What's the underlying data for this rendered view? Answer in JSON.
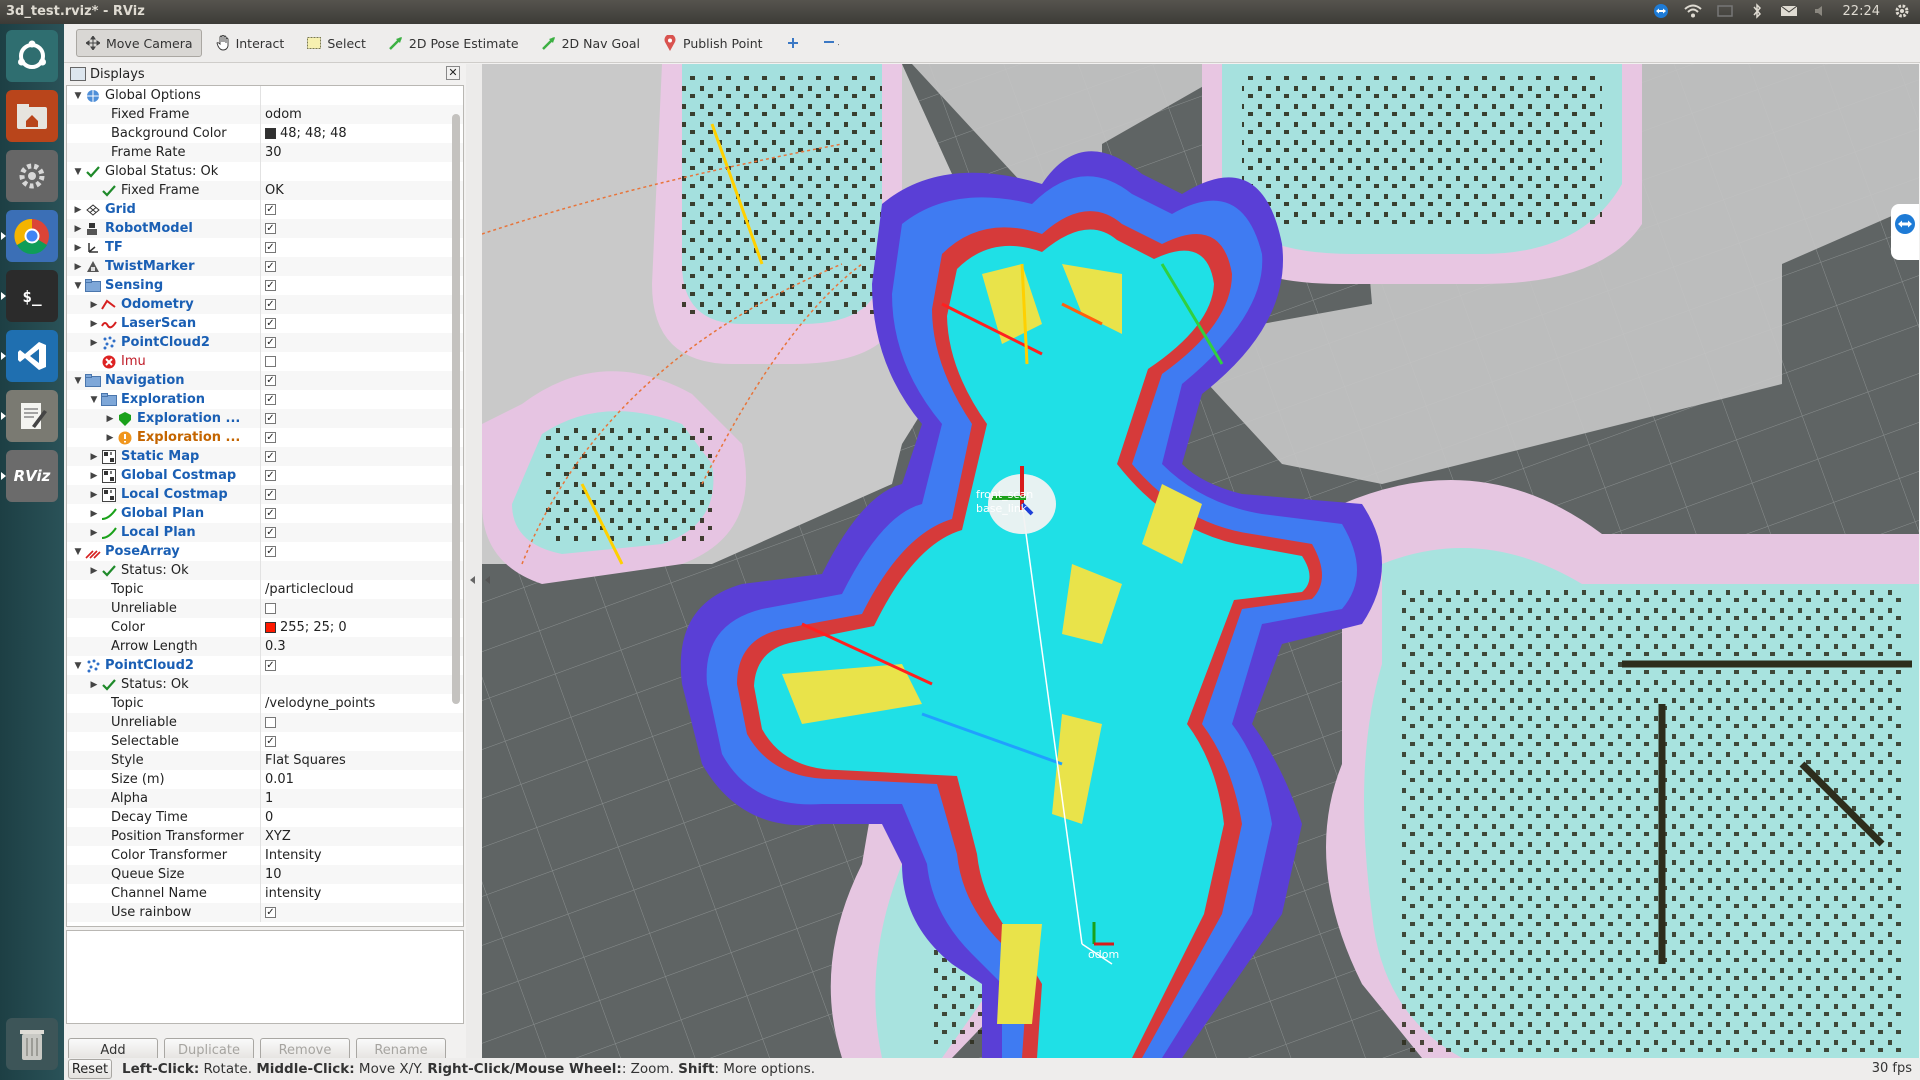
{
  "system_bar": {
    "window_title": "3d_test.rviz* - RViz",
    "clock": "22:24",
    "tray_icons": [
      "teamviewer-icon",
      "wifi-icon",
      "keyboard-icon",
      "bluetooth-icon",
      "mail-icon",
      "volume-icon",
      "gear-icon"
    ]
  },
  "launcher": {
    "items": [
      {
        "name": "ubuntu-dash",
        "icon": "ubuntu-logo-icon",
        "color": "#2f6e70"
      },
      {
        "name": "files",
        "icon": "home-folder-icon",
        "color": "#b9451b"
      },
      {
        "name": "system-settings",
        "icon": "gear-icon",
        "color": "#666666"
      },
      {
        "name": "chrome",
        "icon": "chrome-icon",
        "color": "#3b6fb6"
      },
      {
        "name": "terminal",
        "icon": "terminal-icon",
        "color": "#2b2b2b",
        "text": "$_"
      },
      {
        "name": "vscode",
        "icon": "vscode-icon",
        "color": "#1f6fb0"
      },
      {
        "name": "text-editor",
        "icon": "text-editor-icon",
        "color": "#7a7a72"
      },
      {
        "name": "rviz",
        "icon": "rviz-icon",
        "color": "#6b6b6b",
        "text": "RViz"
      },
      {
        "name": "trash",
        "icon": "trash-icon",
        "color": "#3d5558"
      }
    ]
  },
  "toolbar": {
    "tools": [
      {
        "label": "Move Camera",
        "icon": "move-camera-icon",
        "active": true
      },
      {
        "label": "Interact",
        "icon": "hand-icon",
        "active": false
      },
      {
        "label": "Select",
        "icon": "select-icon",
        "active": false
      },
      {
        "label": "2D Pose Estimate",
        "icon": "pose-estimate-arrow-icon",
        "active": false
      },
      {
        "label": "2D Nav Goal",
        "icon": "nav-goal-arrow-icon",
        "active": false
      },
      {
        "label": "Publish Point",
        "icon": "map-pin-icon",
        "active": false
      },
      {
        "label": "",
        "icon": "plus-icon",
        "active": false
      },
      {
        "label": "",
        "icon": "minus-dropdown-icon",
        "active": false
      }
    ]
  },
  "displays_panel": {
    "title": "Displays",
    "rows": [
      {
        "depth": 0,
        "expand": "open",
        "icon": "globe-icon",
        "name": "Global Options",
        "style": "plain",
        "value": ""
      },
      {
        "depth": 1,
        "expand": "",
        "icon": "",
        "name": "Fixed Frame",
        "style": "plain",
        "value": "odom"
      },
      {
        "depth": 1,
        "expand": "",
        "icon": "",
        "name": "Background Color",
        "style": "plain",
        "value": "48; 48; 48",
        "swatch": "#303030"
      },
      {
        "depth": 1,
        "expand": "",
        "icon": "",
        "name": "Frame Rate",
        "style": "plain",
        "value": "30"
      },
      {
        "depth": 0,
        "expand": "open",
        "icon": "check-icon",
        "name": "Global Status: Ok",
        "style": "plain",
        "value": ""
      },
      {
        "depth": 1,
        "expand": "",
        "icon": "check-icon",
        "name": "Fixed Frame",
        "style": "plain",
        "value": "OK"
      },
      {
        "depth": 0,
        "expand": "closed",
        "icon": "grid-icon",
        "name": "Grid",
        "style": "blue",
        "check": true
      },
      {
        "depth": 0,
        "expand": "closed",
        "icon": "robot-model-icon",
        "name": "RobotModel",
        "style": "blue",
        "check": true
      },
      {
        "depth": 0,
        "expand": "closed",
        "icon": "tf-axes-icon",
        "name": "TF",
        "style": "blue",
        "check": true
      },
      {
        "depth": 0,
        "expand": "closed",
        "icon": "marker-icon",
        "name": "TwistMarker",
        "style": "blue",
        "check": true
      },
      {
        "depth": 0,
        "expand": "open",
        "icon": "folder-icon",
        "name": "Sensing",
        "style": "blue",
        "check": true
      },
      {
        "depth": 1,
        "expand": "closed",
        "icon": "odometry-icon",
        "name": "Odometry",
        "style": "blue",
        "check": true
      },
      {
        "depth": 1,
        "expand": "closed",
        "icon": "laserscan-icon",
        "name": "LaserScan",
        "style": "blue",
        "check": true
      },
      {
        "depth": 1,
        "expand": "closed",
        "icon": "pointcloud-icon",
        "name": "PointCloud2",
        "style": "blue",
        "check": true
      },
      {
        "depth": 1,
        "expand": "",
        "icon": "error-icon",
        "name": "Imu",
        "style": "red",
        "check": false
      },
      {
        "depth": 0,
        "expand": "open",
        "icon": "folder-icon",
        "name": "Navigation",
        "style": "blue",
        "check": true
      },
      {
        "depth": 1,
        "expand": "open",
        "icon": "folder-icon",
        "name": "Exploration",
        "style": "blue",
        "check": true
      },
      {
        "depth": 2,
        "expand": "closed",
        "icon": "green-shield-icon",
        "name": "Exploration ...",
        "style": "blue",
        "check": true
      },
      {
        "depth": 2,
        "expand": "closed",
        "icon": "warning-icon",
        "name": "Exploration ...",
        "style": "orange",
        "check": true
      },
      {
        "depth": 1,
        "expand": "closed",
        "icon": "map-icon",
        "name": "Static Map",
        "style": "blue",
        "check": true
      },
      {
        "depth": 1,
        "expand": "closed",
        "icon": "map-icon",
        "name": "Global Costmap",
        "style": "blue",
        "check": true
      },
      {
        "depth": 1,
        "expand": "closed",
        "icon": "map-icon",
        "name": "Local Costmap",
        "style": "blue",
        "check": true
      },
      {
        "depth": 1,
        "expand": "closed",
        "icon": "path-icon",
        "name": "Global Plan",
        "style": "blue",
        "check": true
      },
      {
        "depth": 1,
        "expand": "closed",
        "icon": "path-icon",
        "name": "Local Plan",
        "style": "blue",
        "check": true
      },
      {
        "depth": 0,
        "expand": "open",
        "icon": "pose-array-icon",
        "name": "PoseArray",
        "style": "blue",
        "check": true
      },
      {
        "depth": 1,
        "expand": "closed",
        "icon": "check-icon",
        "name": "Status: Ok",
        "style": "plain",
        "value": ""
      },
      {
        "depth": 1,
        "expand": "",
        "icon": "",
        "name": "Topic",
        "style": "plain",
        "value": "/particlecloud"
      },
      {
        "depth": 1,
        "expand": "",
        "icon": "",
        "name": "Unreliable",
        "style": "plain",
        "check": false
      },
      {
        "depth": 1,
        "expand": "",
        "icon": "",
        "name": "Color",
        "style": "plain",
        "value": "255; 25; 0",
        "swatch": "#ff1900"
      },
      {
        "depth": 1,
        "expand": "",
        "icon": "",
        "name": "Arrow Length",
        "style": "plain",
        "value": "0.3"
      },
      {
        "depth": 0,
        "expand": "open",
        "icon": "pointcloud-icon",
        "name": "PointCloud2",
        "style": "blue",
        "check": true
      },
      {
        "depth": 1,
        "expand": "closed",
        "icon": "check-icon",
        "name": "Status: Ok",
        "style": "plain",
        "value": ""
      },
      {
        "depth": 1,
        "expand": "",
        "icon": "",
        "name": "Topic",
        "style": "plain",
        "value": "/velodyne_points"
      },
      {
        "depth": 1,
        "expand": "",
        "icon": "",
        "name": "Unreliable",
        "style": "plain",
        "check": false
      },
      {
        "depth": 1,
        "expand": "",
        "icon": "",
        "name": "Selectable",
        "style": "plain",
        "check": true
      },
      {
        "depth": 1,
        "expand": "",
        "icon": "",
        "name": "Style",
        "style": "plain",
        "value": "Flat Squares"
      },
      {
        "depth": 1,
        "expand": "",
        "icon": "",
        "name": "Size (m)",
        "style": "plain",
        "value": "0.01"
      },
      {
        "depth": 1,
        "expand": "",
        "icon": "",
        "name": "Alpha",
        "style": "plain",
        "value": "1"
      },
      {
        "depth": 1,
        "expand": "",
        "icon": "",
        "name": "Decay Time",
        "style": "plain",
        "value": "0"
      },
      {
        "depth": 1,
        "expand": "",
        "icon": "",
        "name": "Position Transformer",
        "style": "plain",
        "value": "XYZ"
      },
      {
        "depth": 1,
        "expand": "",
        "icon": "",
        "name": "Color Transformer",
        "style": "plain",
        "value": "Intensity"
      },
      {
        "depth": 1,
        "expand": "",
        "icon": "",
        "name": "Queue Size",
        "style": "plain",
        "value": "10"
      },
      {
        "depth": 1,
        "expand": "",
        "icon": "",
        "name": "Channel Name",
        "style": "plain",
        "value": "intensity"
      },
      {
        "depth": 1,
        "expand": "",
        "icon": "",
        "name": "Use rainbow",
        "style": "plain",
        "check": true
      }
    ],
    "buttons": [
      {
        "label": "Add",
        "enabled": true
      },
      {
        "label": "Duplicate",
        "enabled": false
      },
      {
        "label": "Remove",
        "enabled": false
      },
      {
        "label": "Rename",
        "enabled": false
      }
    ]
  },
  "viewport": {
    "background_color": "#5f6464",
    "robot_frame_labels": [
      "front_scan",
      "base_link",
      "odom"
    ]
  },
  "statusbar": {
    "reset_label": "Reset",
    "hint_parts": [
      {
        "text": "Left-Click:",
        "bold": true
      },
      {
        "text": " Rotate. ",
        "bold": false
      },
      {
        "text": "Middle-Click:",
        "bold": true
      },
      {
        "text": " Move X/Y. ",
        "bold": false
      },
      {
        "text": "Right-Click/Mouse Wheel:",
        "bold": true
      },
      {
        "text": ": Zoom. ",
        "bold": false
      },
      {
        "text": "Shift",
        "bold": true
      },
      {
        "text": ": More options.",
        "bold": false
      }
    ],
    "fps": "30 fps"
  }
}
